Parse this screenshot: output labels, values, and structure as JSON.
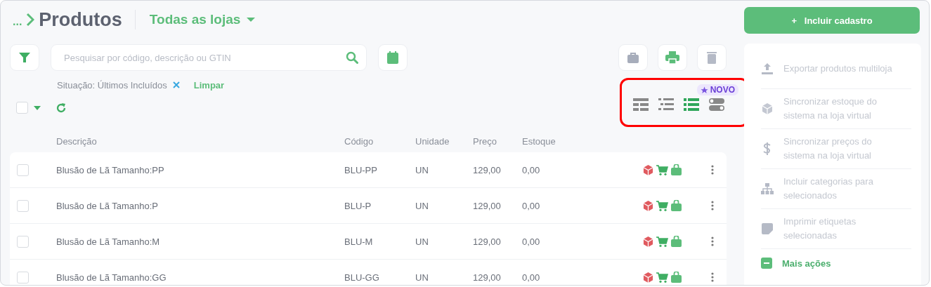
{
  "breadcrumb": {
    "ellipsis": "...",
    "title": "Produtos"
  },
  "store_selector": {
    "label": "Todas as lojas"
  },
  "search": {
    "placeholder": "Pesquisar por código, descrição ou GTIN"
  },
  "filter_tag": {
    "label": "Situação: Últimos Incluídos"
  },
  "clear_link": "Limpar",
  "select_all": {
    "checked": false
  },
  "new_badge": "NOVO",
  "view_modes": [
    {
      "kind": "grid",
      "selected": false
    },
    {
      "kind": "list",
      "selected": false
    },
    {
      "kind": "detailed",
      "selected": true
    },
    {
      "kind": "toggle",
      "selected": false
    }
  ],
  "table": {
    "columns": [
      "Descrição",
      "Código",
      "Unidade",
      "Preço",
      "Estoque"
    ],
    "rows": [
      {
        "description": "Blusão de Lã Tamanho:PP",
        "code": "BLU-PP",
        "unit": "UN",
        "price": "129,00",
        "stock": "0,00",
        "checked": false
      },
      {
        "description": "Blusão de Lã Tamanho:P",
        "code": "BLU-P",
        "unit": "UN",
        "price": "129,00",
        "stock": "0,00",
        "checked": false
      },
      {
        "description": "Blusão de Lã Tamanho:M",
        "code": "BLU-M",
        "unit": "UN",
        "price": "129,00",
        "stock": "0,00",
        "checked": false
      },
      {
        "description": "Blusão de Lã Tamanho:GG",
        "code": "BLU-GG",
        "unit": "UN",
        "price": "129,00",
        "stock": "0,00",
        "checked": false
      }
    ]
  },
  "add_button": {
    "icon": "+",
    "label": "Incluir cadastro"
  },
  "actions": [
    {
      "kind": "export",
      "label": "Exportar produtos multiloja"
    },
    {
      "kind": "stock",
      "label": "Sincronizar estoque do sistema na loja virtual"
    },
    {
      "kind": "price",
      "label": "Sincronizar preços do sistema na loja virtual"
    },
    {
      "kind": "categories",
      "label": "Incluir categorias para selecionados"
    },
    {
      "kind": "labels",
      "label": "Imprimir etiquetas selecionadas"
    }
  ],
  "more_actions": {
    "label": "Mais ações"
  }
}
